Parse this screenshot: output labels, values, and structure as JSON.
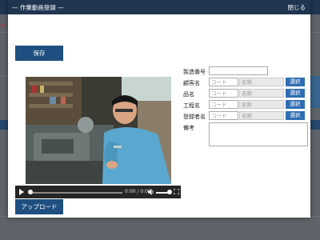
{
  "background": {
    "red_text": "ss"
  },
  "modal": {
    "title": "— 作業動画登録 —",
    "close_label": "閉じる",
    "save_label": "保存",
    "upload_label": "アップロード"
  },
  "video_player": {
    "time_display": "0:00 / 0:00",
    "progress": 0,
    "volume": 0.8,
    "thumbnail": "worker-operating-lathe"
  },
  "form": {
    "serial": {
      "label": "製造番号",
      "value": ""
    },
    "customer": {
      "label": "顧客名",
      "code_placeholder": "コード",
      "name_placeholder": "名称",
      "button": "選択"
    },
    "product": {
      "label": "品名",
      "code_placeholder": "コード",
      "name_placeholder": "名称",
      "button": "選択"
    },
    "process": {
      "label": "工程名",
      "code_placeholder": "コード",
      "name_placeholder": "名称",
      "button": "選択"
    },
    "registrant": {
      "label": "登録者名",
      "code_placeholder": "コード",
      "name_placeholder": "名称",
      "button": "選択"
    },
    "remarks": {
      "label": "備考",
      "value": ""
    }
  },
  "colors": {
    "header": "#1f3550",
    "button_primary": "#1f4f80",
    "select_button": "#2f6eb3"
  }
}
